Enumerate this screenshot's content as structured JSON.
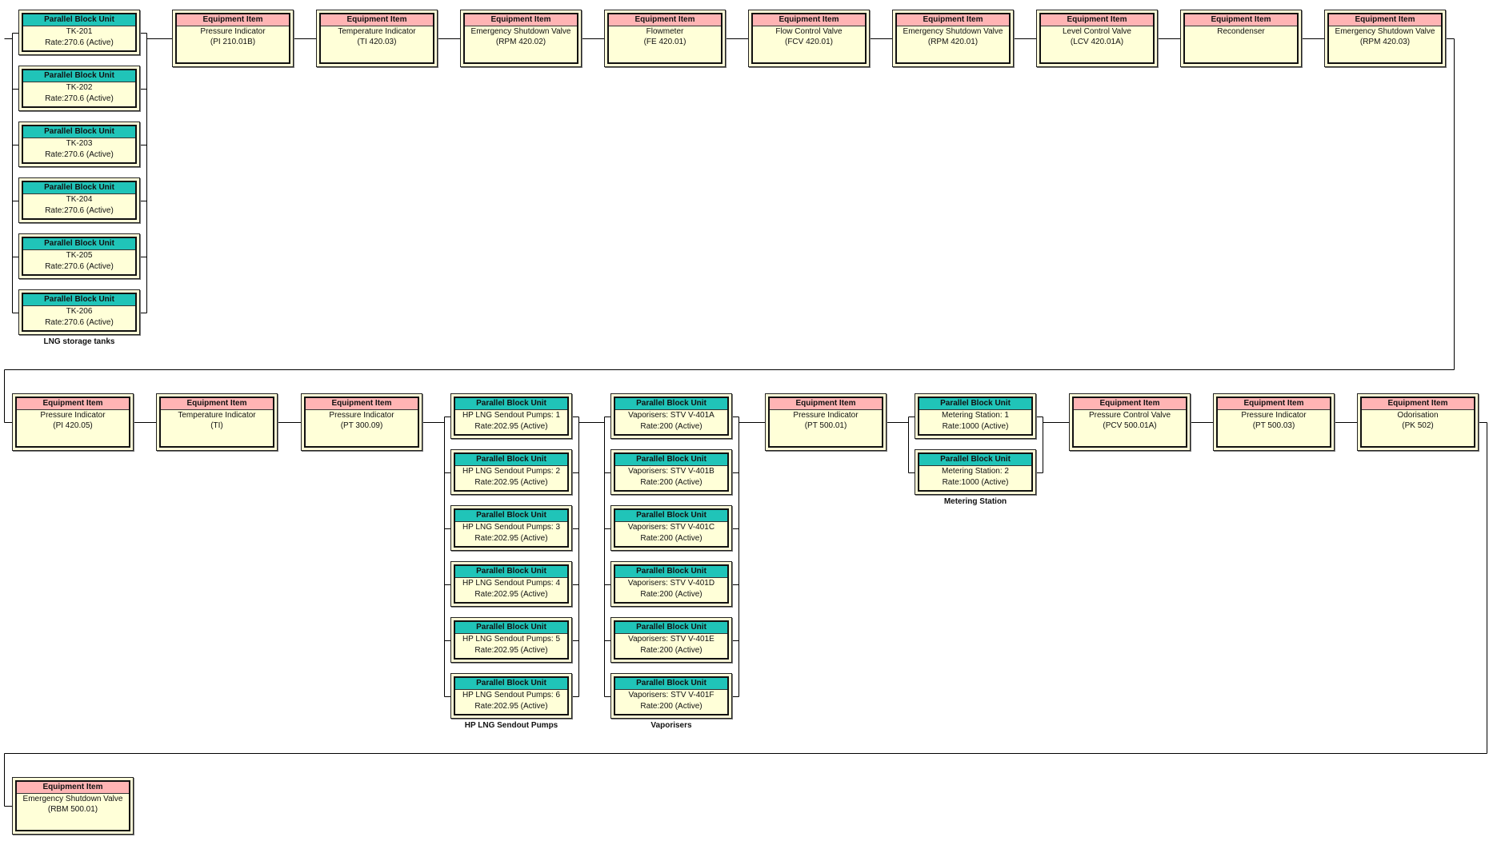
{
  "diagram": {
    "rows": [
      [
        {
          "type": "group",
          "label": "LNG storage tanks",
          "units": [
            {
              "header": "Parallel Block Unit",
              "lines": [
                "TK-201",
                "Rate:270.6 (Active)"
              ]
            },
            {
              "header": "Parallel Block Unit",
              "lines": [
                "TK-202",
                "Rate:270.6 (Active)"
              ]
            },
            {
              "header": "Parallel Block Unit",
              "lines": [
                "TK-203",
                "Rate:270.6 (Active)"
              ]
            },
            {
              "header": "Parallel Block Unit",
              "lines": [
                "TK-204",
                "Rate:270.6 (Active)"
              ]
            },
            {
              "header": "Parallel Block Unit",
              "lines": [
                "TK-205",
                "Rate:270.6 (Active)"
              ]
            },
            {
              "header": "Parallel Block Unit",
              "lines": [
                "TK-206",
                "Rate:270.6 (Active)"
              ]
            }
          ]
        },
        {
          "type": "equipment",
          "header": "Equipment Item",
          "lines": [
            "Pressure Indicator",
            "(PI 210.01B)"
          ]
        },
        {
          "type": "equipment",
          "header": "Equipment Item",
          "lines": [
            "Temperature Indicator",
            "(TI 420.03)"
          ]
        },
        {
          "type": "equipment",
          "header": "Equipment Item",
          "lines": [
            "Emergency Shutdown Valve",
            "(RPM 420.02)"
          ]
        },
        {
          "type": "equipment",
          "header": "Equipment Item",
          "lines": [
            "Flowmeter",
            "(FE 420.01)"
          ]
        },
        {
          "type": "equipment",
          "header": "Equipment Item",
          "lines": [
            "Flow Control Valve",
            "(FCV 420.01)"
          ]
        },
        {
          "type": "equipment",
          "header": "Equipment Item",
          "lines": [
            "Emergency Shutdown Valve",
            "(RPM 420.01)"
          ]
        },
        {
          "type": "equipment",
          "header": "Equipment Item",
          "lines": [
            "Level Control Valve",
            "(LCV 420.01A)"
          ]
        },
        {
          "type": "equipment",
          "header": "Equipment Item",
          "lines": [
            "Recondenser"
          ]
        },
        {
          "type": "equipment",
          "header": "Equipment Item",
          "lines": [
            "Emergency Shutdown Valve",
            "(RPM 420.03)"
          ]
        }
      ],
      [
        {
          "type": "equipment",
          "header": "Equipment Item",
          "lines": [
            "Pressure Indicator",
            "(PI 420.05)"
          ]
        },
        {
          "type": "equipment",
          "header": "Equipment Item",
          "lines": [
            "Temperature Indicator",
            "(TI)"
          ]
        },
        {
          "type": "equipment",
          "header": "Equipment Item",
          "lines": [
            "Pressure Indicator",
            "(PT 300.09)"
          ]
        },
        {
          "type": "group",
          "label": "HP LNG Sendout Pumps",
          "units": [
            {
              "header": "Parallel Block Unit",
              "lines": [
                "HP LNG Sendout Pumps: 1",
                "Rate:202.95 (Active)"
              ]
            },
            {
              "header": "Parallel Block Unit",
              "lines": [
                "HP LNG Sendout Pumps: 2",
                "Rate:202.95 (Active)"
              ]
            },
            {
              "header": "Parallel Block Unit",
              "lines": [
                "HP LNG Sendout Pumps: 3",
                "Rate:202.95 (Active)"
              ]
            },
            {
              "header": "Parallel Block Unit",
              "lines": [
                "HP LNG Sendout Pumps: 4",
                "Rate:202.95 (Active)"
              ]
            },
            {
              "header": "Parallel Block Unit",
              "lines": [
                "HP LNG Sendout Pumps: 5",
                "Rate:202.95 (Active)"
              ]
            },
            {
              "header": "Parallel Block Unit",
              "lines": [
                "HP LNG Sendout Pumps: 6",
                "Rate:202.95 (Active)"
              ]
            }
          ]
        },
        {
          "type": "group",
          "label": "Vaporisers",
          "units": [
            {
              "header": "Parallel Block Unit",
              "lines": [
                "Vaporisers: STV V-401A",
                "Rate:200 (Active)"
              ]
            },
            {
              "header": "Parallel Block Unit",
              "lines": [
                "Vaporisers: STV V-401B",
                "Rate:200 (Active)"
              ]
            },
            {
              "header": "Parallel Block Unit",
              "lines": [
                "Vaporisers: STV V-401C",
                "Rate:200 (Active)"
              ]
            },
            {
              "header": "Parallel Block Unit",
              "lines": [
                "Vaporisers: STV V-401D",
                "Rate:200 (Active)"
              ]
            },
            {
              "header": "Parallel Block Unit",
              "lines": [
                "Vaporisers: STV V-401E",
                "Rate:200 (Active)"
              ]
            },
            {
              "header": "Parallel Block Unit",
              "lines": [
                "Vaporisers: STV V-401F",
                "Rate:200 (Active)"
              ]
            }
          ]
        },
        {
          "type": "equipment",
          "header": "Equipment Item",
          "lines": [
            "Pressure Indicator",
            "(PT 500.01)"
          ]
        },
        {
          "type": "group",
          "label": "Metering Station",
          "units": [
            {
              "header": "Parallel Block Unit",
              "lines": [
                "Metering Station: 1",
                "Rate:1000 (Active)"
              ]
            },
            {
              "header": "Parallel Block Unit",
              "lines": [
                "Metering Station: 2",
                "Rate:1000 (Active)"
              ]
            }
          ]
        },
        {
          "type": "equipment",
          "header": "Equipment Item",
          "lines": [
            "Pressure Control Valve",
            "(PCV 500.01A)"
          ]
        },
        {
          "type": "equipment",
          "header": "Equipment Item",
          "lines": [
            "Pressure Indicator",
            "(PT 500.03)"
          ]
        },
        {
          "type": "equipment",
          "header": "Equipment Item",
          "lines": [
            "Odorisation",
            "(PK 502)"
          ]
        }
      ],
      [
        {
          "type": "equipment",
          "header": "Equipment Item",
          "lines": [
            "Emergency Shutdown Valve",
            "(RBM 500.01)"
          ]
        }
      ]
    ],
    "colors": {
      "equipment_header": "#ffb4b4",
      "pbu_header": "#20c4b8",
      "body": "#ffffd8",
      "line": "#000000"
    }
  }
}
